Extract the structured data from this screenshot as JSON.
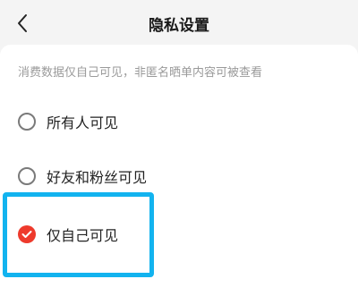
{
  "header": {
    "title": "隐私设置",
    "back_icon": "chevron-left-icon"
  },
  "hint": "消费数据仅自己可见，非匿名晒单内容可被查看",
  "options": [
    {
      "label": "所有人可见",
      "selected": false
    },
    {
      "label": "好友和粉丝可见",
      "selected": false
    },
    {
      "label": "仅自己可见",
      "selected": true
    }
  ],
  "colors": {
    "accent": "#ee3a2c",
    "highlight": "#12b3ef",
    "page_bg": "#f4f4f4",
    "hint_text": "#9a9a9a"
  }
}
